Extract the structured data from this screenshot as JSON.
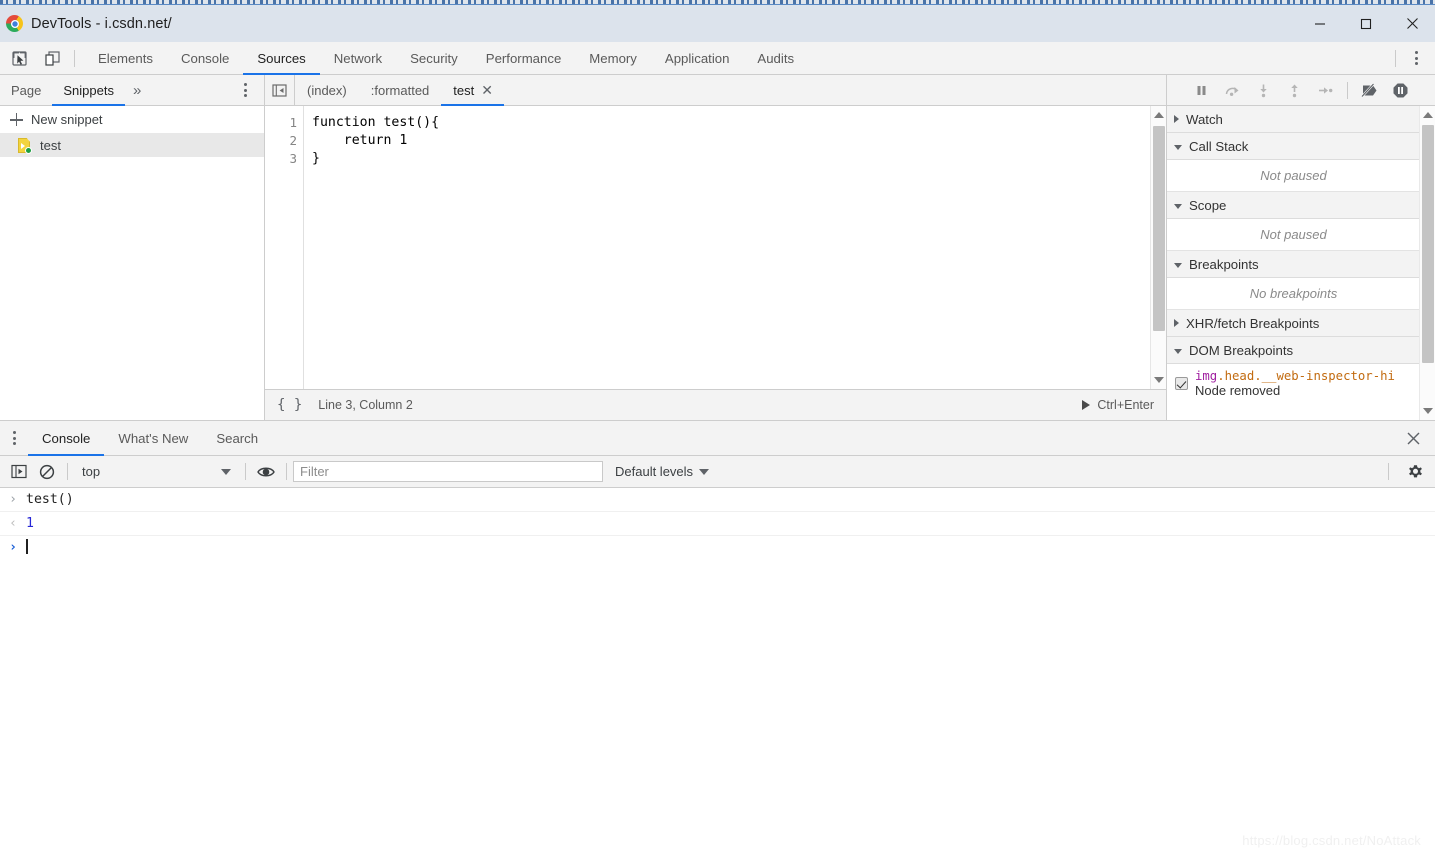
{
  "window": {
    "title": "DevTools - i.csdn.net/",
    "minimize_label": "Minimize",
    "maximize_label": "Maximize",
    "close_label": "Close"
  },
  "main_toolbar": {
    "inspect_icon": "inspect-element-icon",
    "device_icon": "device-toolbar-icon",
    "tabs": [
      {
        "label": "Elements",
        "active": false
      },
      {
        "label": "Console",
        "active": false
      },
      {
        "label": "Sources",
        "active": true
      },
      {
        "label": "Network",
        "active": false
      },
      {
        "label": "Security",
        "active": false
      },
      {
        "label": "Performance",
        "active": false
      },
      {
        "label": "Memory",
        "active": false
      },
      {
        "label": "Application",
        "active": false
      },
      {
        "label": "Audits",
        "active": false
      }
    ],
    "more_label": "Customize and control DevTools"
  },
  "navigator": {
    "tabs": [
      {
        "label": "Page",
        "active": false
      },
      {
        "label": "Snippets",
        "active": true
      }
    ],
    "more_tabs": "»",
    "new_snippet_label": "New snippet",
    "snippets": [
      {
        "name": "test",
        "selected": true
      }
    ]
  },
  "editor": {
    "toggle_navigator_label": "Show navigator",
    "tabs": [
      {
        "label": "(index)",
        "active": false,
        "closable": false
      },
      {
        "label": ":formatted",
        "active": false,
        "closable": false
      },
      {
        "label": "test",
        "active": true,
        "closable": true
      }
    ],
    "close_glyph": "✕",
    "code_lines": [
      {
        "number": "1",
        "text": "function test(){"
      },
      {
        "number": "2",
        "text": "    return 1"
      },
      {
        "number": "3",
        "text": "}"
      }
    ],
    "status": {
      "pretty_print_glyph": "{ }",
      "position": "Line 3, Column 2",
      "run_shortcut": "Ctrl+Enter"
    }
  },
  "debugger": {
    "controls": [
      {
        "name": "resume-script-execution",
        "label": "Resume script execution"
      },
      {
        "name": "step-over-next-function-call",
        "label": "Step over next function call"
      },
      {
        "name": "step-into-next-function-call",
        "label": "Step into next function call"
      },
      {
        "name": "step-out-of-current-function",
        "label": "Step out of current function"
      },
      {
        "name": "step",
        "label": "Step"
      },
      {
        "name": "deactivate-breakpoints",
        "label": "Deactivate breakpoints"
      },
      {
        "name": "pause-on-exceptions",
        "label": "Pause on exceptions"
      }
    ],
    "sections": [
      {
        "title": "Watch",
        "expanded": false,
        "empty_text": null
      },
      {
        "title": "Call Stack",
        "expanded": true,
        "empty_text": "Not paused"
      },
      {
        "title": "Scope",
        "expanded": true,
        "empty_text": "Not paused"
      },
      {
        "title": "Breakpoints",
        "expanded": true,
        "empty_text": "No breakpoints"
      },
      {
        "title": "XHR/fetch Breakpoints",
        "expanded": false,
        "empty_text": null
      },
      {
        "title": "DOM Breakpoints",
        "expanded": true,
        "empty_text": null
      }
    ],
    "dom_breakpoints": [
      {
        "checked": true,
        "selector_tag": "img",
        "selector_rest": ".head.__web-inspector-hi",
        "type": "Node removed"
      }
    ]
  },
  "drawer": {
    "tabs": [
      {
        "label": "Console",
        "active": true
      },
      {
        "label": "What's New",
        "active": false
      },
      {
        "label": "Search",
        "active": false
      }
    ],
    "close_glyph": "✕"
  },
  "console": {
    "toolbar": {
      "sidebar_toggle": "console-sidebar-icon",
      "clear_label": "Clear console",
      "context": "top",
      "eye_label": "Create live expression",
      "filter_placeholder": "Filter",
      "filter_value": "",
      "levels": "Default levels",
      "settings_label": "Console settings"
    },
    "messages": [
      {
        "kind": "input",
        "glyph": "›",
        "text": "test()"
      },
      {
        "kind": "result",
        "glyph": "‹",
        "text": "1"
      },
      {
        "kind": "prompt",
        "glyph": "›",
        "text": ""
      }
    ]
  },
  "watermark": "https://blog.csdn.net/NoAttack",
  "colors": {
    "accent": "#1a73e8",
    "toolbar_bg": "#f3f3f3",
    "titlebar_bg": "#dce3ec",
    "result_blue": "#2727d6",
    "selector_tag": "#a020a0",
    "selector_rest": "#c26b10",
    "snippet_badge_green": "#1c9e3f"
  }
}
